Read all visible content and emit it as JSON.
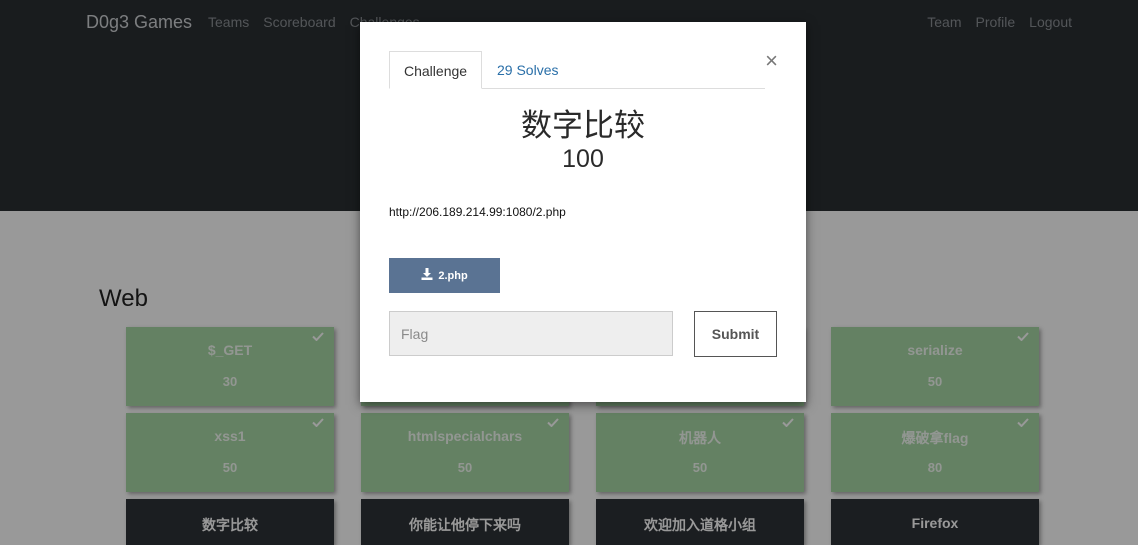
{
  "navbar": {
    "brand": "D0g3 Games",
    "left_links": [
      "Teams",
      "Scoreboard",
      "Challenges"
    ],
    "right_links": [
      "Team",
      "Profile",
      "Logout"
    ]
  },
  "section": {
    "title": "Web"
  },
  "tiles": [
    {
      "name": "$_GET",
      "value": "30",
      "solved": true
    },
    {
      "name": "serialize",
      "value": "50",
      "solved": true
    },
    {
      "name": "xss1",
      "value": "50",
      "solved": true
    },
    {
      "name": "htmlspecialchars",
      "value": "50",
      "solved": true
    },
    {
      "name": "机器人",
      "value": "50",
      "solved": true
    },
    {
      "name": "爆破拿flag",
      "value": "80",
      "solved": true
    },
    {
      "name": "数字比较"
    },
    {
      "name": "你能让他停下来吗"
    },
    {
      "name": "欢迎加入道格小组"
    },
    {
      "name": "Firefox"
    }
  ],
  "modal": {
    "tab_challenge": "Challenge",
    "tab_solves": "29 Solves",
    "close": "×",
    "challenge_name": "数字比较",
    "challenge_value": "100",
    "description": "http://206.189.214.99:1080/2.php",
    "file_label": "2.php",
    "flag_placeholder": "Flag",
    "submit_label": "Submit"
  },
  "colors": {
    "navbar_bg": "#2b2f33",
    "solved_tile": "#a7d8a5",
    "unsolved_tile": "#2e3338",
    "file_button": "#5a7393",
    "link": "#2a6fa8"
  },
  "icons": [
    "check-icon",
    "download-icon",
    "close-icon"
  ]
}
